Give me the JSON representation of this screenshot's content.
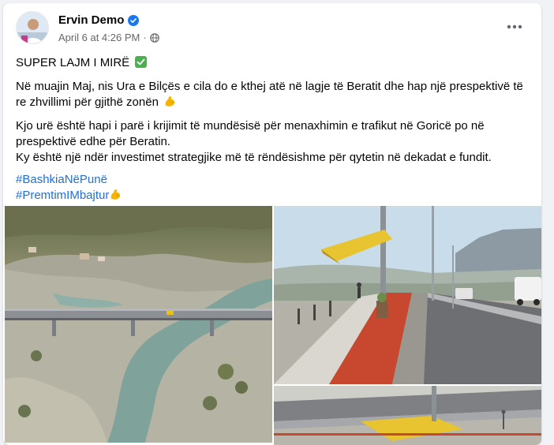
{
  "post": {
    "author": "Ervin Demo",
    "timestamp": "April 6 at 4:26 PM",
    "separator": "·",
    "privacy_icon": "globe-icon",
    "more_icon": "more-icon",
    "headline": "SUPER LAJM I MIRË",
    "paragraph1": "Në muajin Maj, nis Ura e Bilçës e cila do e kthej atë në lagje të Beratit dhe hap një prespektivë të re zhvillimi për gjithë zonën",
    "paragraph2_line1": "Kjo urë është hapi i parë i krijimit të mundësisë për menaxhimin e trafikut në Goricë po në prespektivë edhe për Beratin.",
    "paragraph2_line2": "Ky është një ndër investimet strategjike më të rëndësishme për qytetin në dekadat e fundit.",
    "hashtag1": "#BashkiaNëPunë",
    "hashtag2": "#PremtimIMbajtur"
  },
  "colors": {
    "link": "#216fdb",
    "secondary_text": "#65676b",
    "verified": "#1877f2",
    "check_emoji": "#4caf50",
    "muscle_emoji": "#f4b400"
  }
}
